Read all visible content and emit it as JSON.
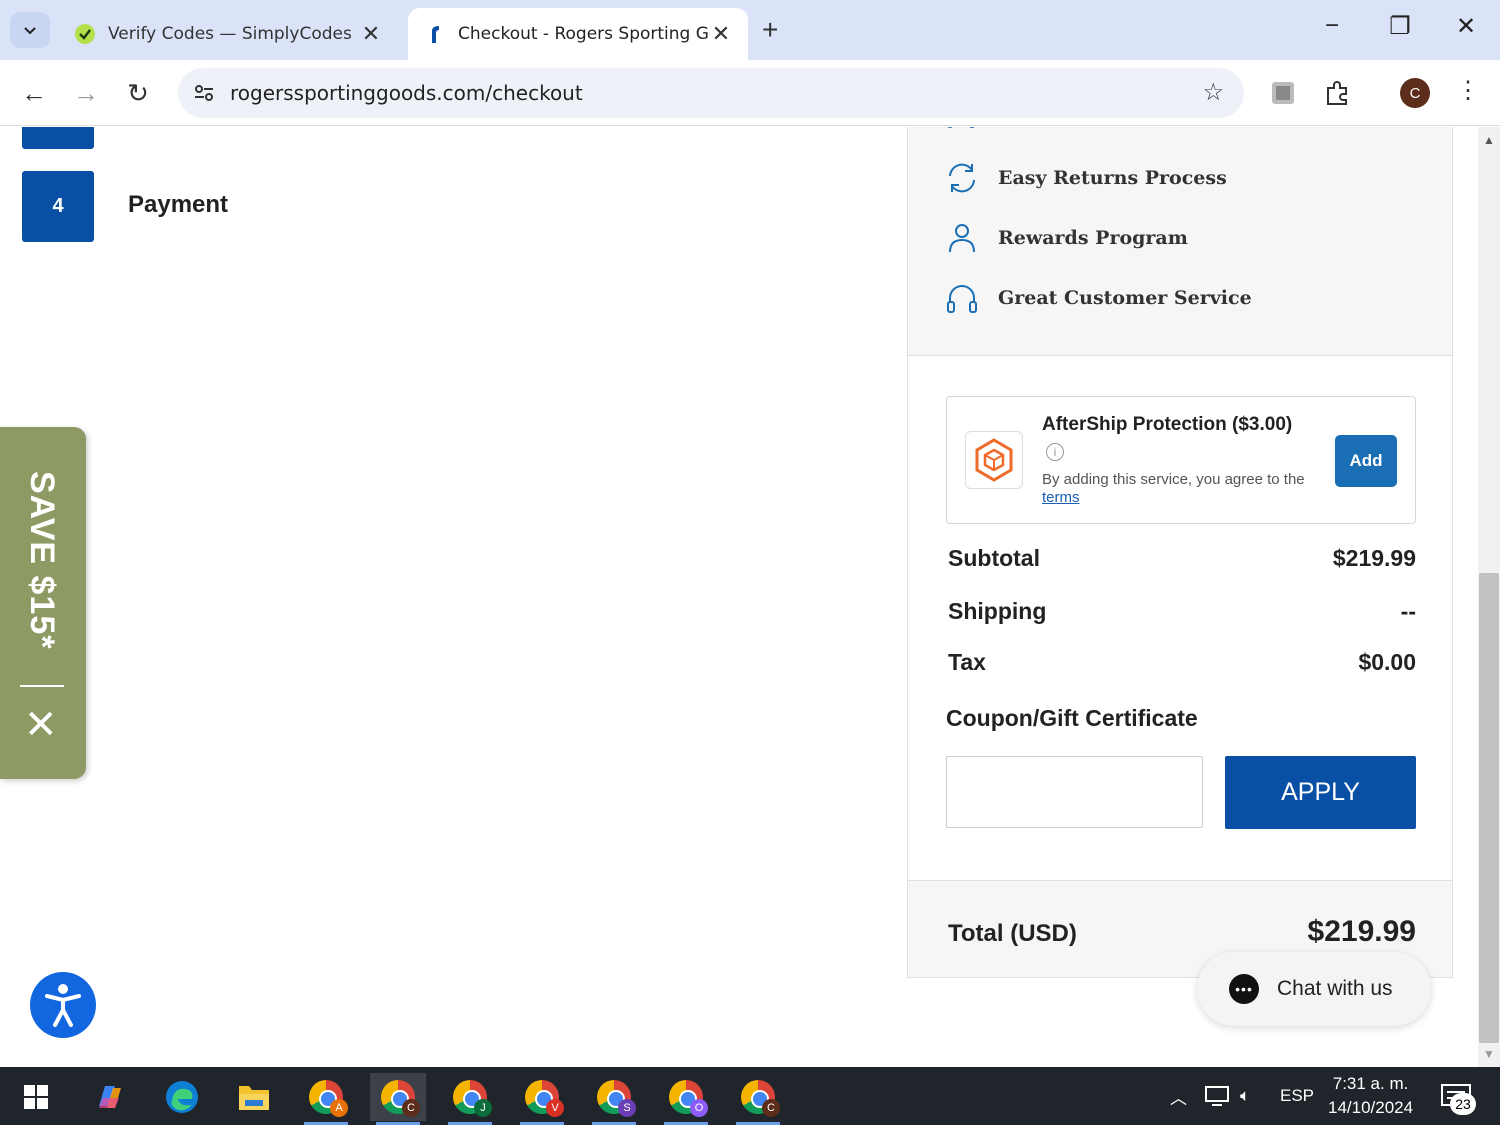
{
  "browser": {
    "tabs": [
      {
        "title": "Verify Codes — SimplyCodes",
        "active": false
      },
      {
        "title": "Checkout - Rogers Sporting Goods",
        "active": true
      }
    ],
    "url": "rogerssportinggoods.com/checkout",
    "profile_initial": "C"
  },
  "checkout": {
    "step": {
      "number": "4",
      "label": "Payment"
    }
  },
  "promo": {
    "save_label": "SAVE $15*"
  },
  "sidebar": {
    "features": [
      {
        "icon": "returns-icon",
        "label": "Easy Returns Process"
      },
      {
        "icon": "user-icon",
        "label": "Rewards Program"
      },
      {
        "icon": "headset-icon",
        "label": "Great Customer Service"
      }
    ],
    "aftership": {
      "title": "AfterShip Protection ($3.00)",
      "desc": "By adding this service, you agree to the",
      "terms_link": "terms",
      "add_label": "Add"
    },
    "summary": [
      {
        "label": "Subtotal",
        "value": "$219.99"
      },
      {
        "label": "Shipping",
        "value": "--"
      },
      {
        "label": "Tax",
        "value": "$0.00"
      }
    ],
    "coupon": {
      "label": "Coupon/Gift Certificate",
      "value": "",
      "placeholder": "",
      "apply_label": "APPLY"
    },
    "total": {
      "label": "Total (USD)",
      "value": "$219.99"
    }
  },
  "chat": {
    "label": "Chat with us"
  },
  "taskbar": {
    "chrome_profiles": [
      {
        "letter": "A",
        "color": "#e8710a"
      },
      {
        "letter": "C",
        "color": "#5b2d1a"
      },
      {
        "letter": "J",
        "color": "#0b6b3a"
      },
      {
        "letter": "V",
        "color": "#d93025"
      },
      {
        "letter": "S",
        "color": "#6a3fb5"
      },
      {
        "letter": "O",
        "color": "#8b5cf6"
      },
      {
        "letter": "C",
        "color": "#5b2d1a"
      }
    ],
    "language": "ESP",
    "time": "7:31 a. m.",
    "date": "14/10/2024",
    "notification_count": "23"
  },
  "colors": {
    "brand_blue": "#0a4fa6",
    "promo_green": "#8e9a63",
    "aftership_orange": "#f06a2a"
  }
}
